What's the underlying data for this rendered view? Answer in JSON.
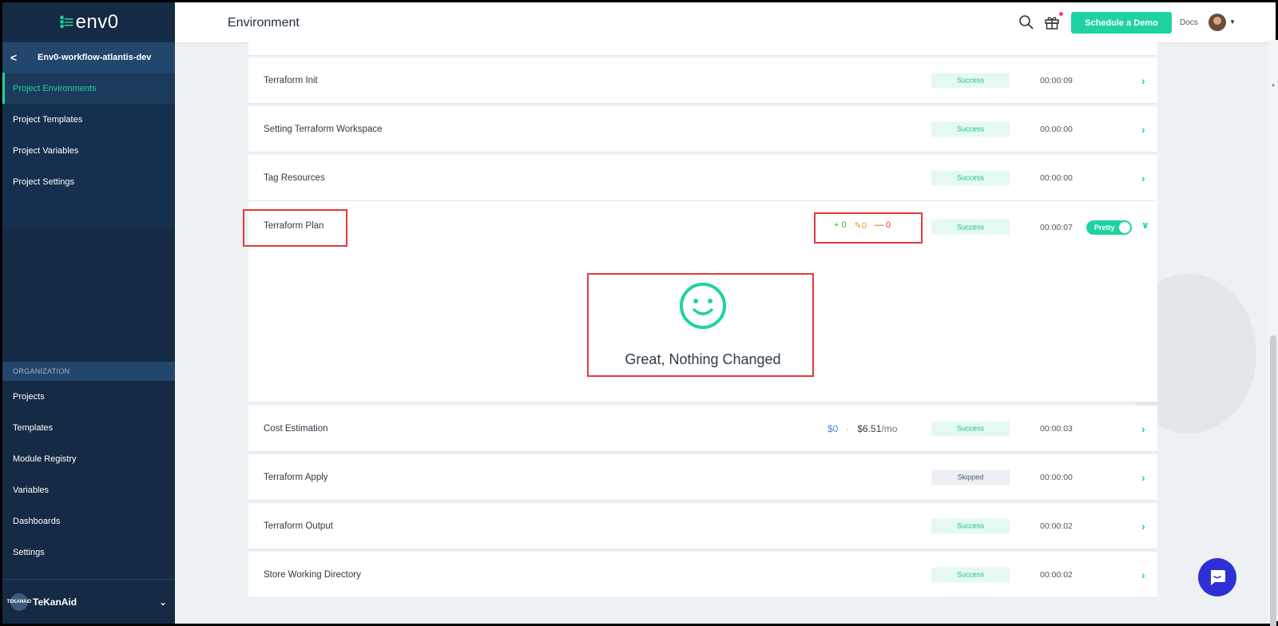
{
  "app": {
    "logo_glyph": "⁝≡",
    "logo_text": "env0"
  },
  "sidebar": {
    "project_name": "Env0-workflow-atlantis-dev",
    "back_icon": "chevron-left-icon",
    "project_items": [
      {
        "label": "Project Environments",
        "active": true
      },
      {
        "label": "Project Templates"
      },
      {
        "label": "Project Variables"
      },
      {
        "label": "Project Settings"
      }
    ],
    "org_label": "ORGANIZATION",
    "org_items": [
      {
        "label": "Projects"
      },
      {
        "label": "Templates"
      },
      {
        "label": "Module Registry"
      },
      {
        "label": "Variables"
      },
      {
        "label": "Dashboards"
      },
      {
        "label": "Settings"
      }
    ],
    "org_name": "TeKanAid",
    "org_avatar_text": "TEKANAID"
  },
  "header": {
    "title": "Environment",
    "demo_button": "Schedule a Demo",
    "docs": "Docs",
    "accent": "#1ed3a1"
  },
  "steps": [
    {
      "name": "Terraform Init",
      "status": "Success",
      "duration": "00:00:09"
    },
    {
      "name": "Setting Terraform Workspace",
      "status": "Success",
      "duration": "00:00:00"
    },
    {
      "name": "Tag Resources",
      "status": "Success",
      "duration": "00:00:00"
    },
    {
      "name": "Terraform Plan",
      "status": "Success",
      "duration": "00:00:07",
      "add": "0",
      "change": "0",
      "destroy": "0",
      "toggle_label": "Pretty",
      "message": "Great, Nothing Changed"
    },
    {
      "name": "Cost Estimation",
      "status": "Success",
      "duration": "00:00:03",
      "cost_before": "$0",
      "separator": "·",
      "cost_after": "$6.51",
      "cost_unit": "/mo"
    },
    {
      "name": "Terraform Apply",
      "status": "Skipped",
      "duration": "00:00:00"
    },
    {
      "name": "Terraform Output",
      "status": "Success",
      "duration": "00:00:02"
    },
    {
      "name": "Store Working Directory",
      "status": "Success",
      "duration": "00:00:02"
    }
  ],
  "icons": {
    "arrow": "›",
    "chevron_down": "⌄",
    "plus": "+",
    "minus": "—"
  }
}
